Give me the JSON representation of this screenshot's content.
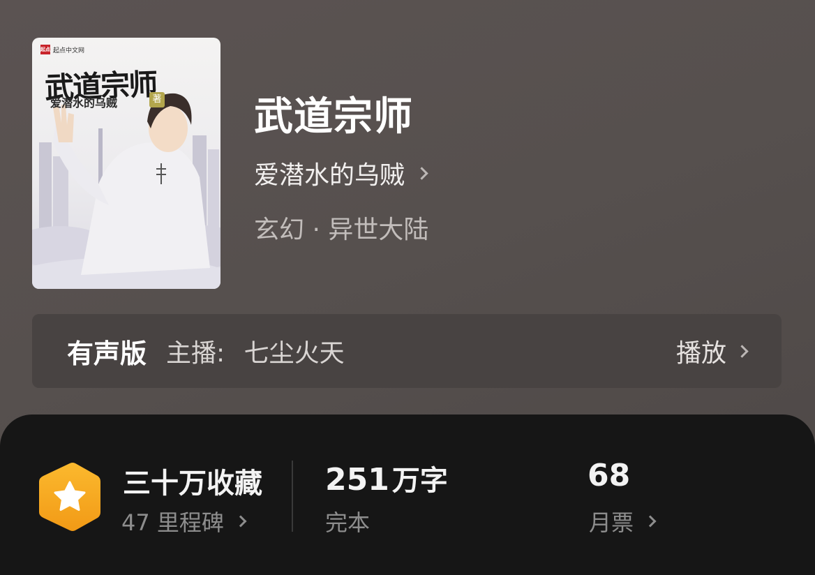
{
  "cover": {
    "logo_mark": "起点",
    "logo_text": "起点中文网",
    "title": "武道宗师",
    "author": "爱潜水的乌贼",
    "author_mark": "著"
  },
  "book": {
    "title": "武道宗师",
    "author": "爱潜水的乌贼",
    "genre": "玄幻 · 异世大陆"
  },
  "audio": {
    "title": "有声版",
    "host_label": "主播:",
    "host_name": "七尘火天",
    "play_label": "播放"
  },
  "stats": {
    "collections": "三十万收藏",
    "milestones": "47 里程碑",
    "word_count": "251",
    "word_unit": "万字",
    "status": "完本",
    "monthly_tickets": "68",
    "monthly_label": "月票"
  },
  "icons": {
    "star_badge": "star-icon",
    "badge_color": "#f5a623"
  }
}
